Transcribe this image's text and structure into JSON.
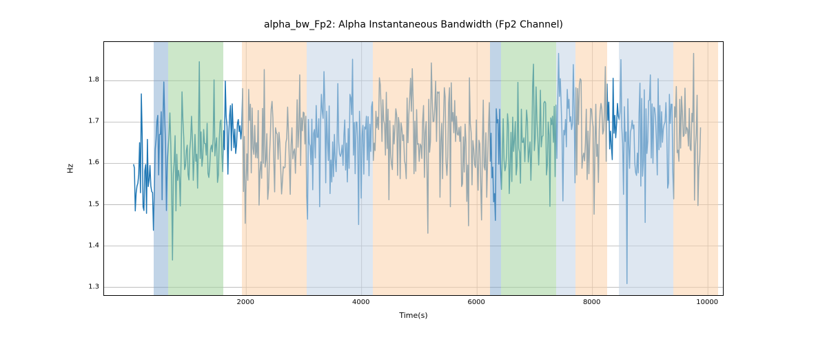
{
  "chart_data": {
    "type": "line",
    "title": "alpha_bw_Fp2: Alpha Instantaneous Bandwidth (Fp2 Channel)",
    "xlabel": "Time(s)",
    "ylabel": "Hz",
    "xlim": [
      -462.705,
      10260.705
    ],
    "ylim": [
      1.2811734003082218,
      1.893754285299624
    ],
    "xticks": [
      2000,
      4000,
      6000,
      8000,
      10000
    ],
    "yticks": [
      1.3,
      1.4,
      1.5,
      1.6,
      1.7,
      1.8
    ],
    "bands": [
      {
        "x0": 400,
        "x1": 650,
        "color": "blue"
      },
      {
        "x0": 650,
        "x1": 1600,
        "color": "green"
      },
      {
        "x0": 1920,
        "x1": 3050,
        "color": "peach"
      },
      {
        "x0": 3050,
        "x1": 4200,
        "color": "lblue"
      },
      {
        "x0": 4200,
        "x1": 4850,
        "color": "peach"
      },
      {
        "x0": 4850,
        "x1": 6220,
        "color": "peach"
      },
      {
        "x0": 6220,
        "x1": 6420,
        "color": "blue"
      },
      {
        "x0": 6420,
        "x1": 7370,
        "color": "green"
      },
      {
        "x0": 7370,
        "x1": 7700,
        "color": "lblue"
      },
      {
        "x0": 7700,
        "x1": 8250,
        "color": "peach"
      },
      {
        "x0": 8460,
        "x1": 9400,
        "color": "lblue"
      },
      {
        "x0": 9400,
        "x1": 10180,
        "color": "peach"
      }
    ],
    "series": [
      {
        "name": "alpha_bw_Fp2",
        "color": "#1f77b4",
        "x_step": 15,
        "x_start": 48,
        "values": [
          1.598,
          1.589,
          1.485,
          1.528,
          1.545,
          1.552,
          1.573,
          1.65,
          1.529,
          1.768,
          1.667,
          1.495,
          1.486,
          1.582,
          1.597,
          1.479,
          1.658,
          1.544,
          1.56,
          1.595,
          1.545,
          1.532,
          1.529,
          1.438,
          1.526,
          1.634,
          1.657,
          1.701,
          1.716,
          1.572,
          1.67,
          1.67,
          1.725,
          1.512,
          1.703,
          1.797,
          1.709,
          1.643,
          1.486,
          1.601,
          1.637,
          1.671,
          1.722,
          1.648,
          1.549,
          1.366,
          1.575,
          1.604,
          1.667,
          1.485,
          1.622,
          1.559,
          1.583,
          1.567,
          1.497,
          1.62,
          1.773,
          1.706,
          1.663,
          1.585,
          1.594,
          1.631,
          1.644,
          1.573,
          1.56,
          1.633,
          1.659,
          1.714,
          1.66,
          1.559,
          1.613,
          1.67,
          1.605,
          1.622,
          1.54,
          1.664,
          1.846,
          1.612,
          1.676,
          1.593,
          1.614,
          1.682,
          1.648,
          1.648,
          1.62,
          1.697,
          1.576,
          1.566,
          1.592,
          1.634,
          1.644,
          1.628,
          1.66,
          1.802,
          1.618,
          1.644,
          1.662,
          1.554,
          1.572,
          1.657,
          1.7,
          1.705,
          1.624,
          1.58,
          1.679,
          1.633,
          1.799,
          1.714,
          1.69,
          1.574,
          1.668,
          1.716,
          1.74,
          1.631,
          1.744,
          1.686,
          1.638,
          1.683,
          1.624,
          1.645,
          1.696,
          1.706,
          1.677,
          1.691,
          1.659,
          1.683,
          1.781,
          1.532,
          1.665,
          1.455,
          1.553,
          1.623,
          1.559,
          1.779,
          1.704,
          1.743,
          1.577,
          1.734,
          1.637,
          1.622,
          1.692,
          1.614,
          1.65,
          1.613,
          1.728,
          1.499,
          1.58,
          1.604,
          1.564,
          1.733,
          1.6,
          1.827,
          1.591,
          1.609,
          1.672,
          1.513,
          1.54,
          1.615,
          1.665,
          1.731,
          1.75,
          1.709,
          1.609,
          1.531,
          1.686,
          1.674,
          1.671,
          1.61,
          1.675,
          1.65,
          1.589,
          1.526,
          1.557,
          1.592,
          1.589,
          1.591,
          1.65,
          1.661,
          1.736,
          1.673,
          1.604,
          1.525,
          1.644,
          1.686,
          1.611,
          1.628,
          1.635,
          1.576,
          1.647,
          1.754,
          1.639,
          1.684,
          1.814,
          1.595,
          1.71,
          1.679,
          1.724,
          1.722,
          1.647,
          1.714,
          1.522,
          1.465,
          1.706,
          1.649,
          1.642,
          1.597,
          1.707,
          1.536,
          1.673,
          1.682,
          1.613,
          1.74,
          1.663,
          1.663,
          1.708,
          1.495,
          1.696,
          1.767,
          1.727,
          1.709,
          1.822,
          1.742,
          1.553,
          1.726,
          1.655,
          1.607,
          1.739,
          1.527,
          1.608,
          1.555,
          1.652,
          1.568,
          1.67,
          1.61,
          1.58,
          1.638,
          1.793,
          1.652,
          1.623,
          1.617,
          1.625,
          1.644,
          1.595,
          1.667,
          1.705,
          1.584,
          1.649,
          1.555,
          1.684,
          1.588,
          1.767,
          1.759,
          1.718,
          1.852,
          1.62,
          1.699,
          1.575,
          1.7,
          1.7,
          1.647,
          1.452,
          1.726,
          1.656,
          1.516,
          1.669,
          1.692,
          1.574,
          1.688,
          1.683,
          1.714,
          1.608,
          1.713,
          1.57,
          1.695,
          1.629,
          1.737,
          1.749,
          1.607,
          1.649,
          1.631,
          1.726,
          1.686,
          1.712,
          1.682,
          1.807,
          1.791,
          1.734,
          1.653,
          1.754,
          1.704,
          1.695,
          1.62,
          1.772,
          1.636,
          1.731,
          1.512,
          1.703,
          1.624,
          1.598,
          1.585,
          1.692,
          1.647,
          1.688,
          1.732,
          1.716,
          1.571,
          1.711,
          1.694,
          1.563,
          1.698,
          1.684,
          1.655,
          1.669,
          1.606,
          1.597,
          1.563,
          1.758,
          1.65,
          1.718,
          1.756,
          1.806,
          1.726,
          1.829,
          1.755,
          1.575,
          1.702,
          1.581,
          1.73,
          1.646,
          1.648,
          1.605,
          1.647,
          1.643,
          1.612,
          1.703,
          1.74,
          1.566,
          1.674,
          1.701,
          1.577,
          1.431,
          1.755,
          1.627,
          1.653,
          1.843,
          1.757,
          1.701,
          1.702,
          1.736,
          1.799,
          1.653,
          1.773,
          1.77,
          1.773,
          1.518,
          1.653,
          1.697,
          1.563,
          1.697,
          1.783,
          1.76,
          1.604,
          1.571,
          1.616,
          1.746,
          1.783,
          1.495,
          1.795,
          1.702,
          1.723,
          1.674,
          1.752,
          1.653,
          1.714,
          1.671,
          1.668,
          1.687,
          1.653,
          1.689,
          1.544,
          1.551,
          1.664,
          1.579,
          1.695,
          1.651,
          1.508,
          1.596,
          1.449,
          1.807,
          1.697,
          1.674,
          1.548,
          1.655,
          1.634,
          1.597,
          1.59,
          1.705,
          1.602,
          1.535,
          1.656,
          1.647,
          1.553,
          1.463,
          1.64,
          1.753,
          1.592,
          1.584,
          1.674,
          1.518,
          1.604,
          1.682,
          1.747,
          1.605,
          1.673,
          1.565,
          1.591,
          1.507,
          1.527,
          1.462,
          1.732,
          1.698,
          1.706,
          1.598,
          1.731,
          1.588,
          1.537,
          1.623,
          1.708,
          1.608,
          1.582,
          1.593,
          1.624,
          1.72,
          1.694,
          1.527,
          1.592,
          1.675,
          1.556,
          1.712,
          1.629,
          1.656,
          1.701,
          1.572,
          1.594,
          1.796,
          1.637,
          1.626,
          1.552,
          1.731,
          1.651,
          1.651,
          1.662,
          1.604,
          1.664,
          1.729,
          1.702,
          1.603,
          1.629,
          1.652,
          1.559,
          1.635,
          1.785,
          1.84,
          1.631,
          1.66,
          1.785,
          1.703,
          1.662,
          1.596,
          1.662,
          1.777,
          1.64,
          1.665,
          1.667,
          1.746,
          1.75,
          1.746,
          1.572,
          1.595,
          1.7,
          1.669,
          1.496,
          1.71,
          1.694,
          1.714,
          1.651,
          1.738,
          1.568,
          1.741,
          1.612,
          1.747,
          1.866,
          1.762,
          1.805,
          1.741,
          1.668,
          1.509,
          1.68,
          1.669,
          1.706,
          1.64,
          1.779,
          1.733,
          1.755,
          1.701,
          1.713,
          1.682,
          1.696,
          1.839,
          1.735,
          1.553,
          1.783,
          1.572,
          1.781,
          1.694,
          1.79,
          1.805,
          1.801,
          1.588,
          1.615,
          1.625,
          1.606,
          1.649,
          1.731,
          1.561,
          1.678,
          1.575,
          1.66,
          1.733,
          1.731,
          1.703,
          1.688,
          1.477,
          1.635,
          1.743,
          1.617,
          1.646,
          1.554,
          1.681,
          1.726,
          1.745,
          1.73,
          1.671,
          1.68,
          1.724,
          1.834,
          1.605,
          1.792,
          1.704,
          1.748,
          1.635,
          1.678,
          1.641,
          1.609,
          1.806,
          1.673,
          1.716,
          1.662,
          1.695,
          1.745,
          1.715,
          1.706,
          1.724,
          1.851,
          1.688,
          1.648,
          1.525,
          1.737,
          1.653,
          1.676,
          1.309,
          1.756,
          1.647,
          1.588,
          1.676,
          1.685,
          1.704,
          1.684,
          1.693,
          1.601,
          1.578,
          1.571,
          1.625,
          1.577,
          1.722,
          1.794,
          1.545,
          1.757,
          1.569,
          1.607,
          1.778,
          1.457,
          1.732,
          1.624,
          1.653,
          1.752,
          1.753,
          1.814,
          1.613,
          1.744,
          1.6,
          1.736,
          1.733,
          1.709,
          1.655,
          1.572,
          1.805,
          1.633,
          1.74,
          1.639,
          1.725,
          1.651,
          1.684,
          1.695,
          1.7,
          1.747,
          1.68,
          1.54,
          1.552,
          1.767,
          1.697,
          1.743,
          1.743,
          1.577,
          1.514,
          1.737,
          1.712,
          1.786,
          1.626,
          1.632,
          1.605,
          1.755,
          1.637,
          1.762,
          1.723,
          1.665,
          1.668,
          1.782,
          1.672,
          1.687,
          1.682,
          1.642,
          1.733,
          1.635,
          1.631,
          1.721,
          1.7,
          1.866,
          1.511,
          1.639,
          1.672,
          1.765,
          1.498,
          1.59,
          1.607,
          1.687
        ]
      }
    ]
  }
}
